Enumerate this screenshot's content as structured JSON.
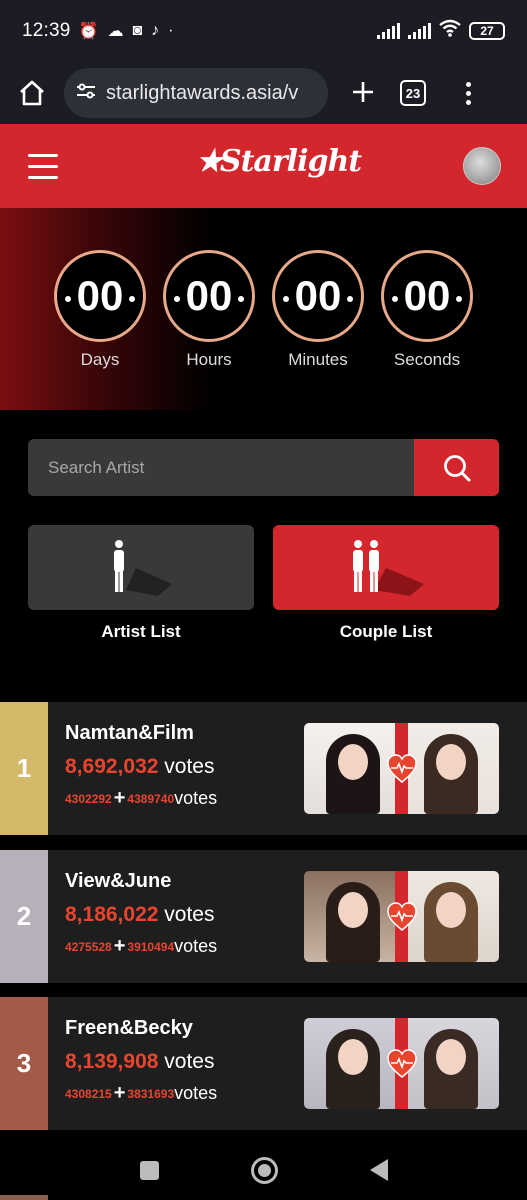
{
  "status_bar": {
    "time": "12:39",
    "icons": [
      "alarm-icon",
      "cloud-game-icon",
      "instagram-icon",
      "tiktok-icon",
      "dot-icon"
    ],
    "battery": "27"
  },
  "browser": {
    "url": "starlightawards.asia/v",
    "tab_count": "23"
  },
  "site": {
    "logo_text": "Starlight",
    "brand_color": "#d3262d"
  },
  "countdown": [
    {
      "value": "00",
      "label": "Days"
    },
    {
      "value": "00",
      "label": "Hours"
    },
    {
      "value": "00",
      "label": "Minutes"
    },
    {
      "value": "00",
      "label": "Seconds"
    }
  ],
  "search": {
    "placeholder": "Search Artist"
  },
  "list_buttons": {
    "artist": "Artist List",
    "couple": "Couple List"
  },
  "rankings": [
    {
      "rank": "1",
      "name": "Namtan&Film",
      "votes": "8,692,032",
      "votes_word": "votes",
      "a": "4302292",
      "b": "4389740",
      "color": "#d4b96b"
    },
    {
      "rank": "2",
      "name": "View&June",
      "votes": "8,186,022",
      "votes_word": "votes",
      "a": "4275528",
      "b": "3910494",
      "color": "#b6b0bb"
    },
    {
      "rank": "3",
      "name": "Freen&Becky",
      "votes": "8,139,908",
      "votes_word": "votes",
      "a": "4308215",
      "b": "3831693",
      "color": "#a35a47"
    }
  ]
}
